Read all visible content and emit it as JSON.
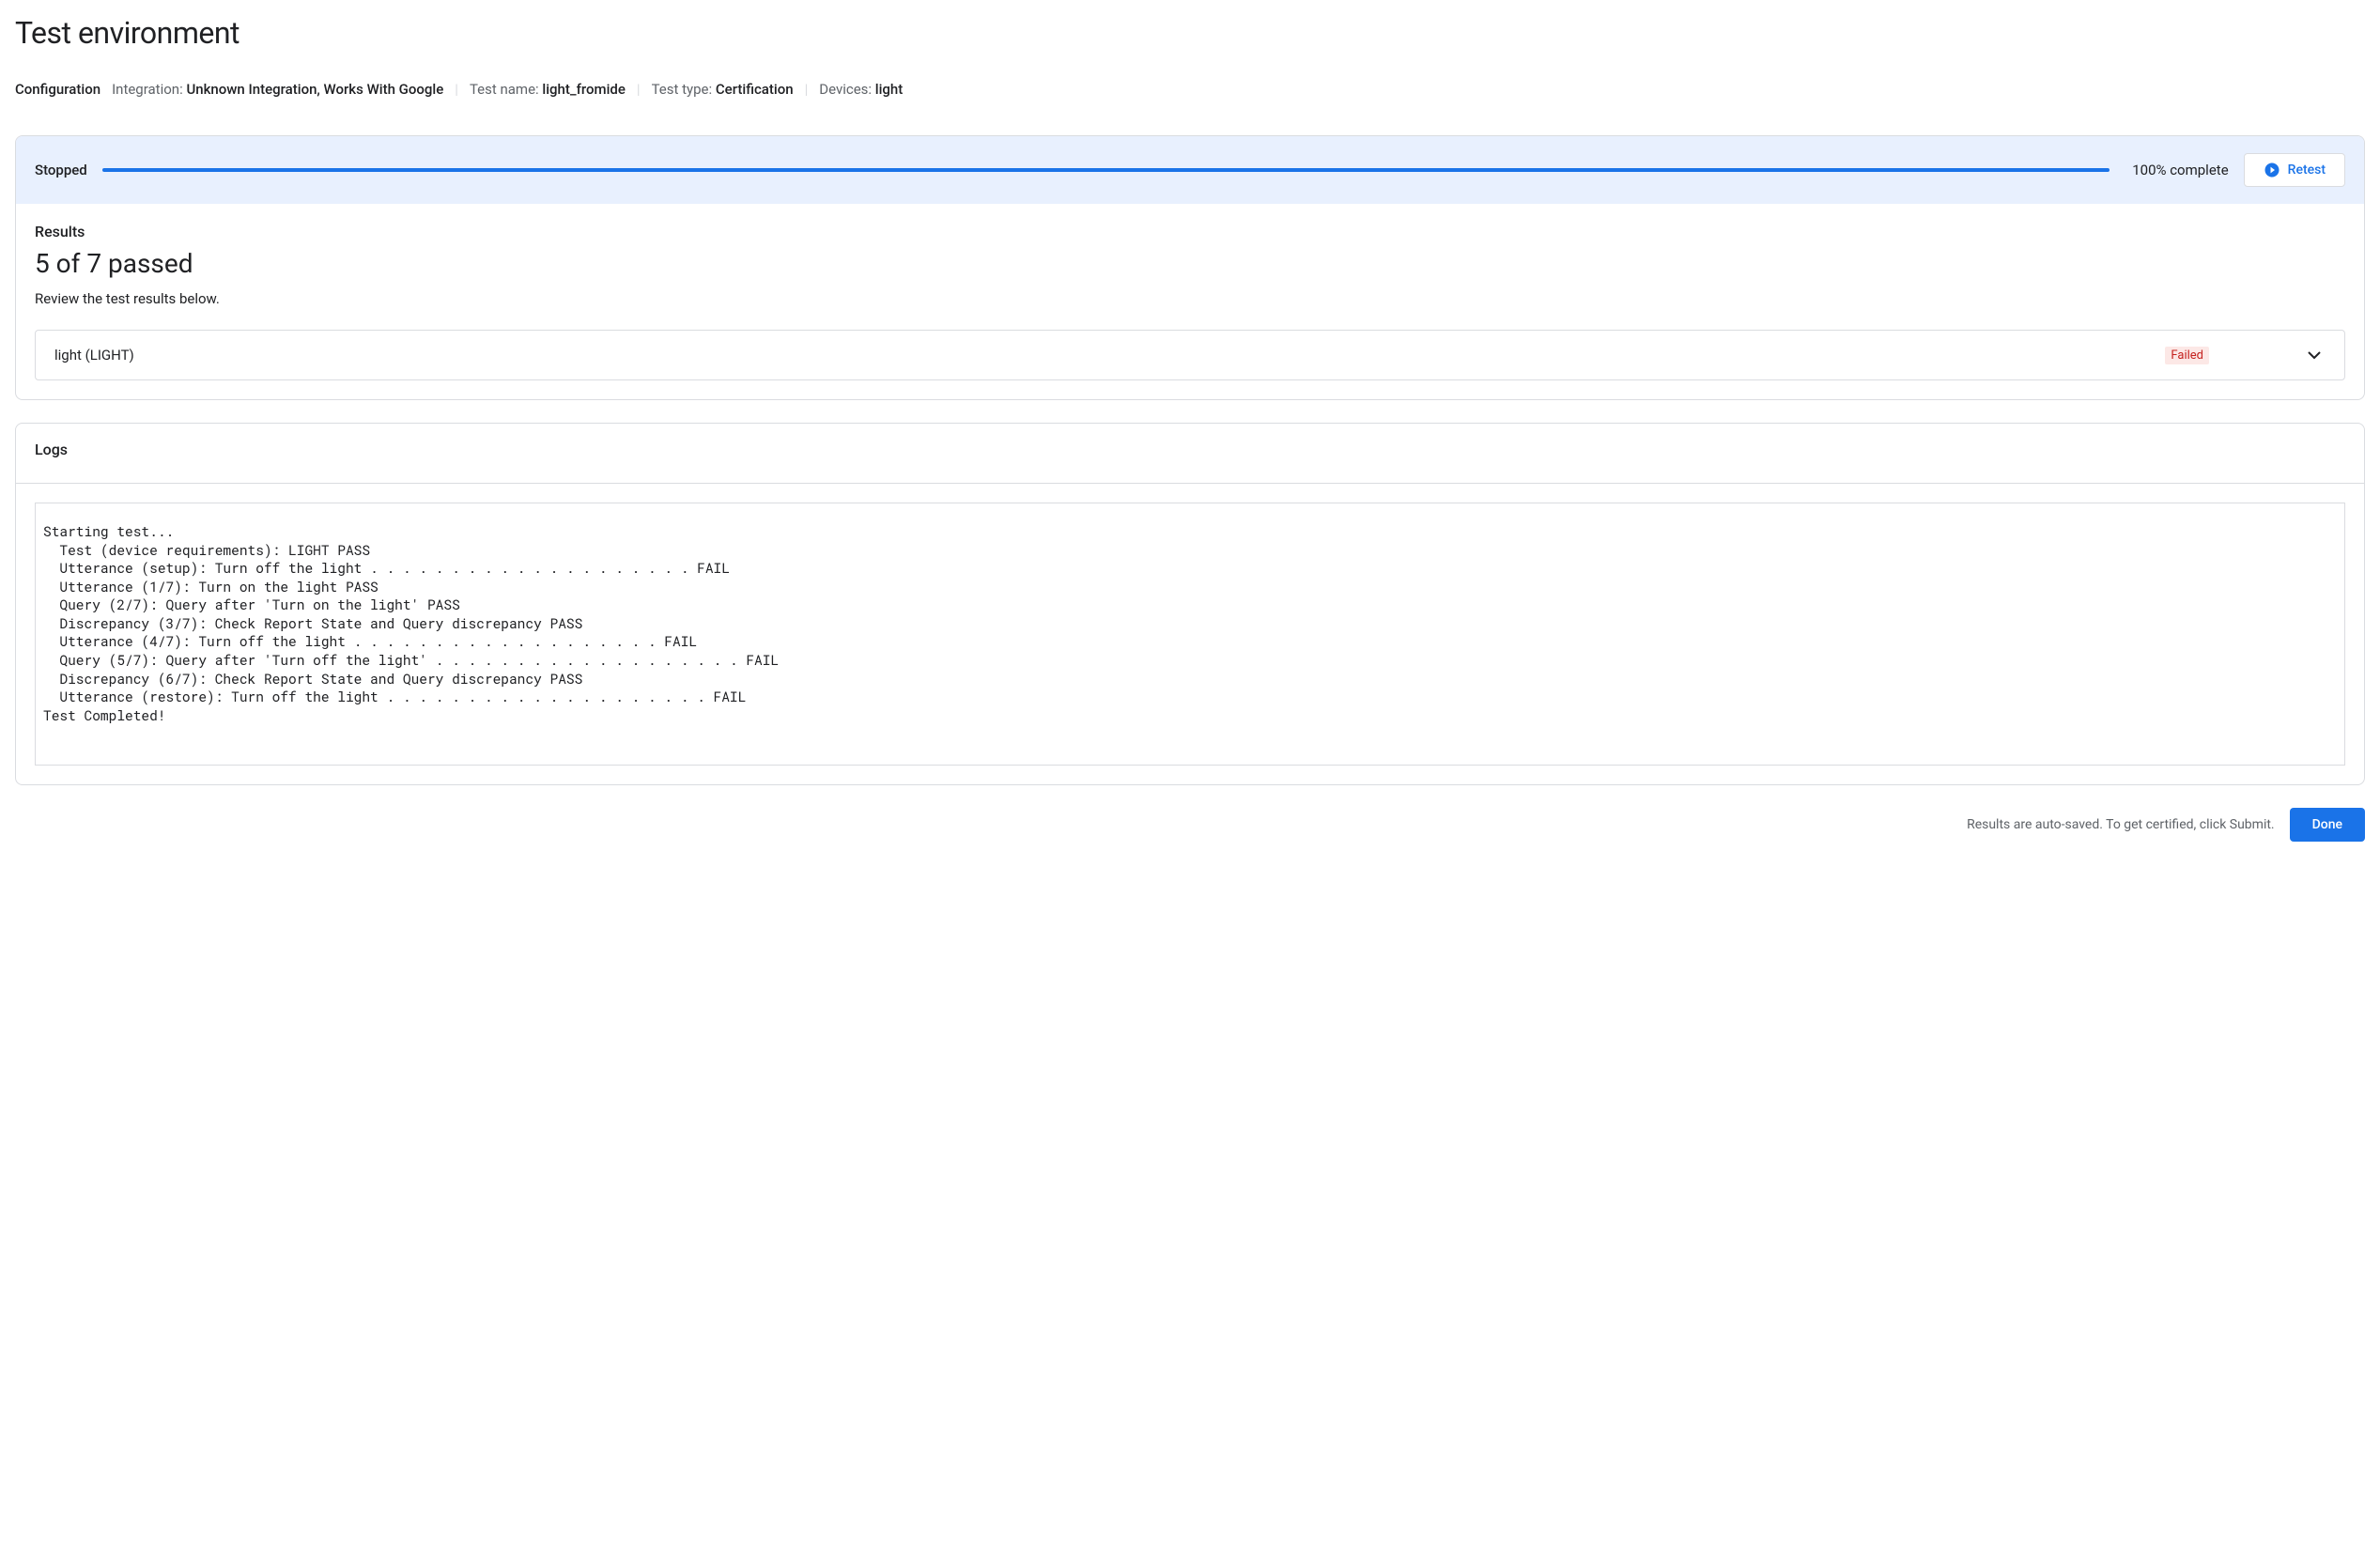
{
  "page_title": "Test environment",
  "config": {
    "label": "Configuration",
    "integration_label": "Integration:",
    "integration_value": "Unknown Integration, Works With Google",
    "test_name_label": "Test name:",
    "test_name_value": "light_fromide",
    "test_type_label": "Test type:",
    "test_type_value": "Certification",
    "devices_label": "Devices:",
    "devices_value": "light"
  },
  "status": {
    "state": "Stopped",
    "progress_text": "100% complete",
    "retest_label": "Retest"
  },
  "results": {
    "title": "Results",
    "summary": "5 of 7 passed",
    "hint": "Review the test results below.",
    "items": [
      {
        "name": "light (LIGHT)",
        "badge": "Failed"
      }
    ]
  },
  "logs": {
    "title": "Logs",
    "content": "Starting test...\n  Test (device requirements): LIGHT PASS\n  Utterance (setup): Turn off the light . . . . . . . . . . . . . . . . . . . . FAIL\n  Utterance (1/7): Turn on the light PASS\n  Query (2/7): Query after 'Turn on the light' PASS\n  Discrepancy (3/7): Check Report State and Query discrepancy PASS\n  Utterance (4/7): Turn off the light . . . . . . . . . . . . . . . . . . . FAIL\n  Query (5/7): Query after 'Turn off the light' . . . . . . . . . . . . . . . . . . . FAIL\n  Discrepancy (6/7): Check Report State and Query discrepancy PASS\n  Utterance (restore): Turn off the light . . . . . . . . . . . . . . . . . . . . FAIL\nTest Completed!"
  },
  "footer": {
    "text": "Results are auto-saved. To get certified, click Submit.",
    "done_label": "Done"
  }
}
